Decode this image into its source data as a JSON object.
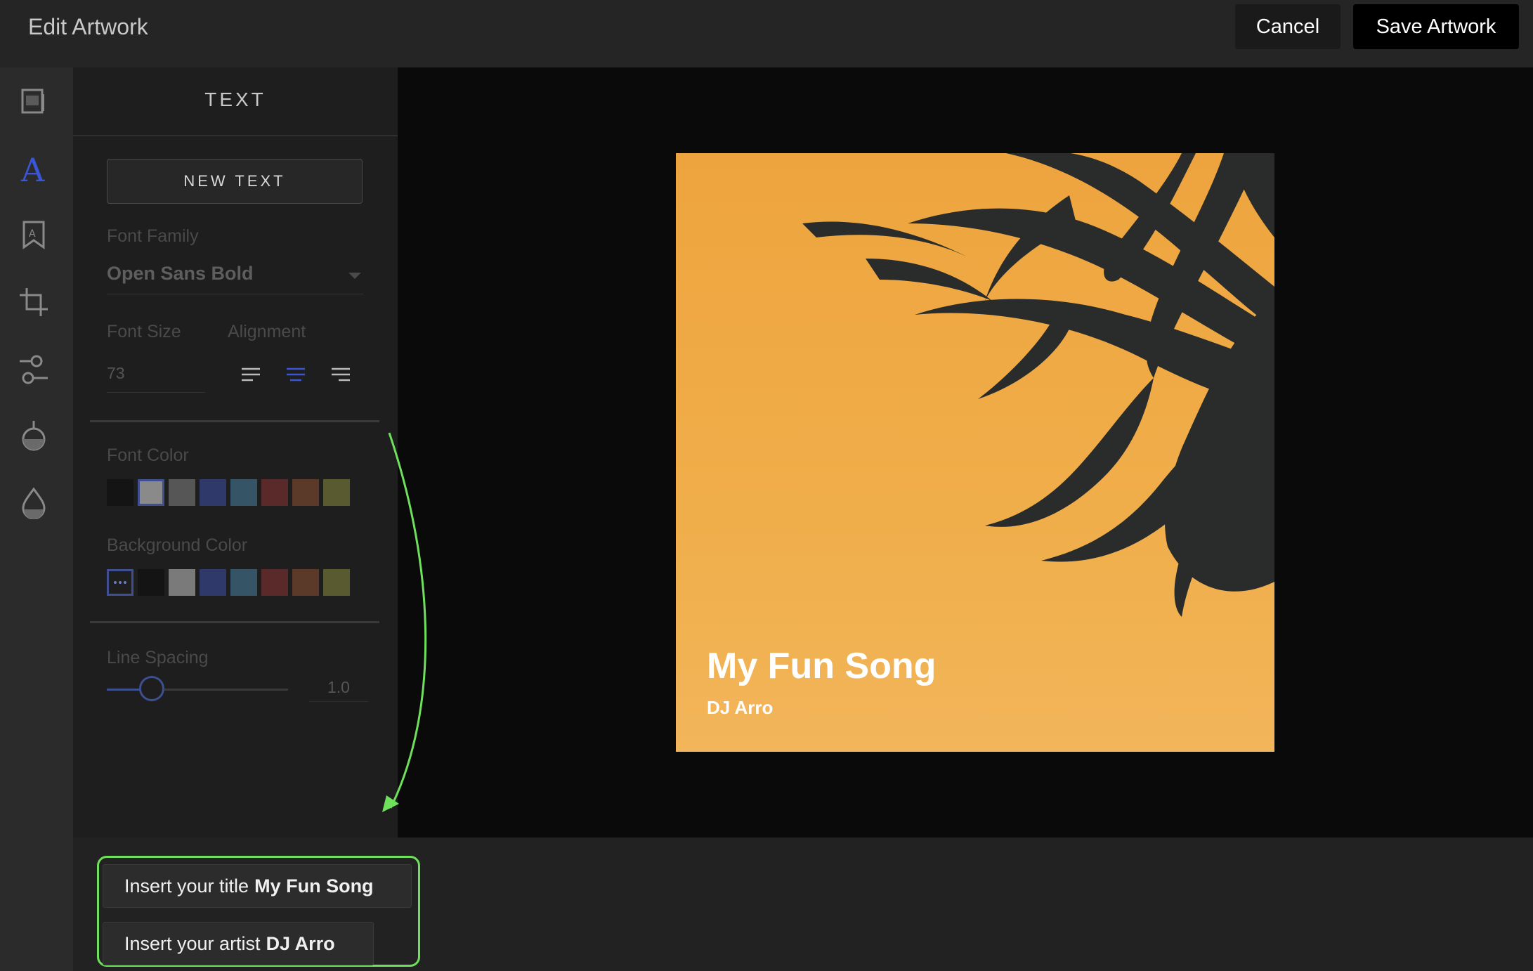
{
  "header": {
    "title": "Edit Artwork",
    "cancel_label": "Cancel",
    "save_label": "Save Artwork"
  },
  "rail": {
    "items": [
      {
        "name": "image-icon",
        "active": false
      },
      {
        "name": "text-icon",
        "active": true
      },
      {
        "name": "bookmark-icon",
        "active": false
      },
      {
        "name": "crop-icon",
        "active": false
      },
      {
        "name": "adjust-icon",
        "active": false
      },
      {
        "name": "filter-flask-icon",
        "active": false
      },
      {
        "name": "drop-icon",
        "active": false
      }
    ],
    "accent_color": "#3a55d8"
  },
  "panel": {
    "title": "TEXT",
    "new_text_label": "NEW TEXT",
    "font_family_label": "Font Family",
    "font_family_value": "Open Sans Bold",
    "font_size_label": "Font Size",
    "font_size_value": "73",
    "alignment_label": "Alignment",
    "alignment_options": [
      "left",
      "center",
      "right"
    ],
    "alignment_selected": "center",
    "font_color_label": "Font Color",
    "font_colors": [
      "#141414",
      "#8a8a8a",
      "#565656",
      "#303a6a",
      "#355466",
      "#5a2a2a",
      "#5c3a2a",
      "#5a5a30"
    ],
    "font_color_selected": 1,
    "background_color_label": "Background Color",
    "background_colors": [
      "none",
      "#141414",
      "#7a7a7a",
      "#303a6a",
      "#355466",
      "#5a2a2a",
      "#5c3a2a",
      "#5a5a30"
    ],
    "background_color_selected": 0,
    "line_spacing_label": "Line Spacing",
    "line_spacing_value": "1.0"
  },
  "artwork": {
    "title": "My Fun Song",
    "artist": "DJ Arro",
    "background_color": "#eea43e",
    "foliage_color": "#2a2c2b"
  },
  "inserts": {
    "title_prefix": "Insert your title",
    "title_value": "My Fun Song",
    "artist_prefix": "Insert your artist",
    "artist_value": "DJ Arro"
  },
  "annotation_color": "#6ee05b"
}
